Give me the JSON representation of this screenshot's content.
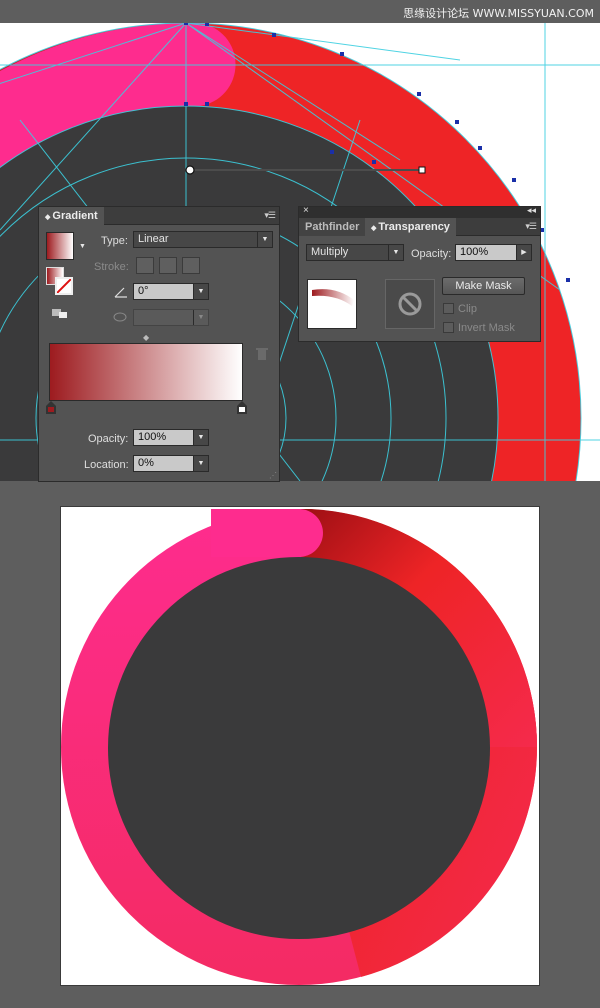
{
  "header": {
    "watermark": "思缘设计论坛 WWW.MISSYUAN.COM"
  },
  "colors": {
    "pink": "#fe2c8e",
    "red": "#ee2426",
    "dark_red": "#9d0f14",
    "disc": "#3a3a3b",
    "guides": "#3ccfe0",
    "panel": "#535353"
  },
  "gradient_panel": {
    "tab_label": "Gradient",
    "type_label": "Type:",
    "type_value": "Linear",
    "stroke_label": "Stroke:",
    "angle_value": "0°",
    "ramp_start_color": "#9d1b1f",
    "ramp_end_color": "#ffffff",
    "opacity_label": "Opacity:",
    "opacity_value": "100%",
    "location_label": "Location:",
    "location_value": "0%"
  },
  "transparency_panel": {
    "tabs": [
      "Pathfinder",
      "Transparency"
    ],
    "blend_mode": "Multiply",
    "opacity_label": "Opacity:",
    "opacity_value": "100%",
    "make_mask_label": "Make Mask",
    "clip_label": "Clip",
    "invert_mask_label": "Invert Mask"
  },
  "icons": [
    "collapse-arrows-icon",
    "panel-menu-icon",
    "close-x-icon",
    "no-mask-icon",
    "trash-icon",
    "stroke-align-icon",
    "angle-icon",
    "aspect-ratio-icon",
    "reverse-gradient-icon",
    "gradient-midpoint-icon",
    "color-stop-icon"
  ]
}
